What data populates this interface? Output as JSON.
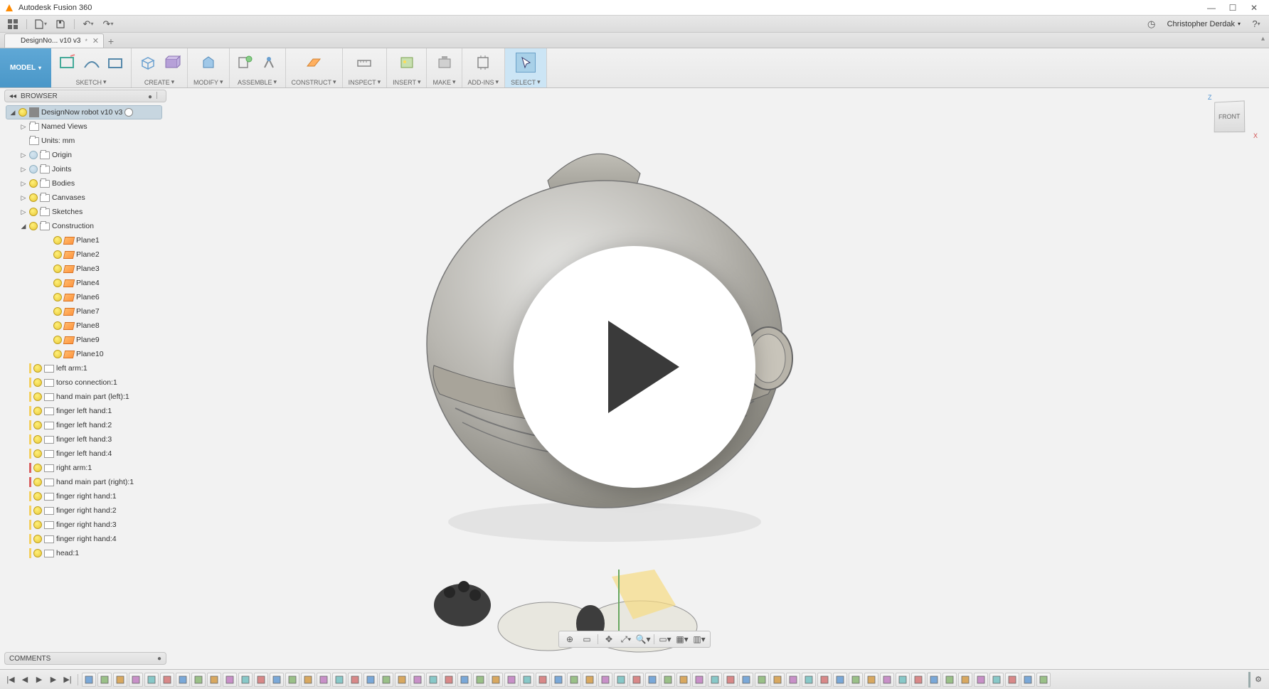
{
  "window": {
    "title": "Autodesk Fusion 360"
  },
  "qat_user": "Christopher Derdak",
  "file_tab": {
    "name": "DesignNo... v10 v3",
    "dirty": "*"
  },
  "workspace": "MODEL",
  "ribbon": [
    {
      "label": "SKETCH"
    },
    {
      "label": "CREATE"
    },
    {
      "label": "MODIFY"
    },
    {
      "label": "ASSEMBLE"
    },
    {
      "label": "CONSTRUCT"
    },
    {
      "label": "INSPECT"
    },
    {
      "label": "INSERT"
    },
    {
      "label": "MAKE"
    },
    {
      "label": "ADD-INS"
    },
    {
      "label": "SELECT"
    }
  ],
  "browser": {
    "title": "BROWSER",
    "root": "DesignNow robot v10 v3",
    "items": [
      {
        "label": "Named Views",
        "type": "folder",
        "exp": true,
        "bulb": false,
        "indent": 1
      },
      {
        "label": "Units: mm",
        "type": "folder",
        "exp": false,
        "bulb": false,
        "indent": 1
      },
      {
        "label": "Origin",
        "type": "folder",
        "exp": true,
        "bulb": true,
        "bulbState": "off",
        "indent": 1
      },
      {
        "label": "Joints",
        "type": "folder",
        "exp": true,
        "bulb": true,
        "bulbState": "off",
        "indent": 1
      },
      {
        "label": "Bodies",
        "type": "folder",
        "exp": true,
        "bulb": true,
        "indent": 1
      },
      {
        "label": "Canvases",
        "type": "folder",
        "exp": true,
        "bulb": true,
        "indent": 1
      },
      {
        "label": "Sketches",
        "type": "folder",
        "exp": true,
        "bulb": true,
        "indent": 1
      },
      {
        "label": "Construction",
        "type": "folder",
        "exp": true,
        "expanded": true,
        "bulb": true,
        "indent": 1
      },
      {
        "label": "Plane1",
        "type": "plane",
        "indent": 3
      },
      {
        "label": "Plane2",
        "type": "plane",
        "indent": 3
      },
      {
        "label": "Plane3",
        "type": "plane",
        "indent": 3
      },
      {
        "label": "Plane4",
        "type": "plane",
        "indent": 3
      },
      {
        "label": "Plane6",
        "type": "plane",
        "indent": 3
      },
      {
        "label": "Plane7",
        "type": "plane",
        "indent": 3
      },
      {
        "label": "Plane8",
        "type": "plane",
        "indent": 3
      },
      {
        "label": "Plane9",
        "type": "plane",
        "indent": 3
      },
      {
        "label": "Plane10",
        "type": "plane",
        "indent": 3
      },
      {
        "label": "left arm:1",
        "type": "comp",
        "stripe": "#f5d060",
        "indent": 1
      },
      {
        "label": "torso connection:1",
        "type": "comp",
        "stripe": "#f5d060",
        "indent": 1
      },
      {
        "label": "hand main part (left):1",
        "type": "comp",
        "stripe": "#f5d060",
        "indent": 1
      },
      {
        "label": "finger left hand:1",
        "type": "comp",
        "stripe": "#f5d060",
        "indent": 1
      },
      {
        "label": "finger left hand:2",
        "type": "comp",
        "stripe": "#f5d060",
        "indent": 1
      },
      {
        "label": "finger left hand:3",
        "type": "comp",
        "stripe": "#f5d060",
        "indent": 1
      },
      {
        "label": "finger left hand:4",
        "type": "comp",
        "stripe": "#f5d060",
        "indent": 1
      },
      {
        "label": "right arm:1",
        "type": "comp",
        "stripe": "#d96060",
        "indent": 1
      },
      {
        "label": "hand main part (right):1",
        "type": "comp",
        "stripe": "#d96060",
        "indent": 1
      },
      {
        "label": "finger right hand:1",
        "type": "comp",
        "stripe": "#f5d060",
        "indent": 1
      },
      {
        "label": "finger right hand:2",
        "type": "comp",
        "stripe": "#f5d060",
        "indent": 1
      },
      {
        "label": "finger right hand:3",
        "type": "comp",
        "stripe": "#f5d060",
        "indent": 1
      },
      {
        "label": "finger right hand:4",
        "type": "comp",
        "stripe": "#f5d060",
        "indent": 1
      },
      {
        "label": "head:1",
        "type": "comp",
        "stripe": "#f5d060",
        "indent": 1
      }
    ]
  },
  "comments": {
    "title": "COMMENTS"
  },
  "viewcube": {
    "face": "FRONT",
    "axis_z": "Z",
    "axis_x": "X"
  },
  "timeline_feature_count": 62
}
